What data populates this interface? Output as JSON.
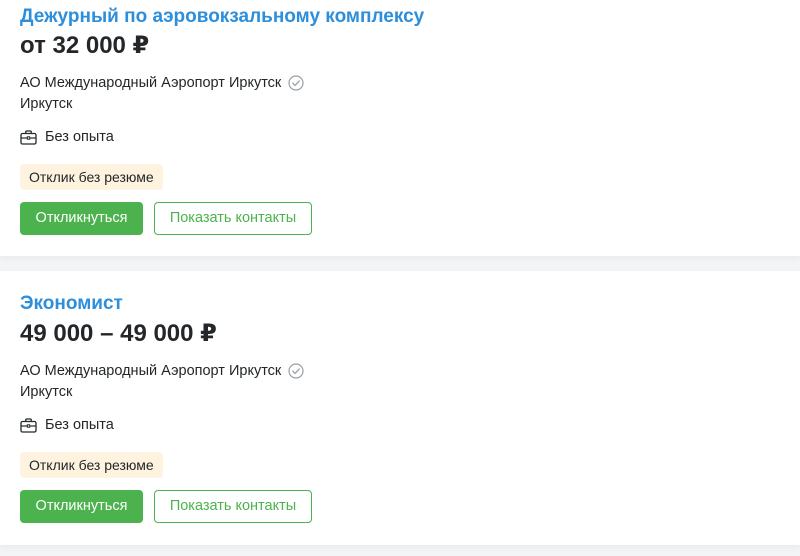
{
  "colors": {
    "title_link": "#2d8fdb",
    "primary_button": "#4bb24e",
    "badge_background": "#fdf3df",
    "verified_icon": "#9aa0a6"
  },
  "vacancies": [
    {
      "title": "Дежурный по аэровокзальному комплексу",
      "salary": "от 32 000 ₽",
      "company": "АО Международный Аэропорт Иркутск",
      "company_icon": "verified-check-icon",
      "city": "Иркутск",
      "experience_icon": "briefcase-icon",
      "experience": "Без опыта",
      "badge": "Отклик без резюме",
      "respond_label": "Откликнуться",
      "contacts_label": "Показать контакты"
    },
    {
      "title": "Экономист",
      "salary": "49 000 – 49 000 ₽",
      "company": "АО Международный Аэропорт Иркутск",
      "company_icon": "verified-check-icon",
      "city": "Иркутск",
      "experience_icon": "briefcase-icon",
      "experience": "Без опыта",
      "badge": "Отклик без резюме",
      "respond_label": "Откликнуться",
      "contacts_label": "Показать контакты"
    }
  ]
}
